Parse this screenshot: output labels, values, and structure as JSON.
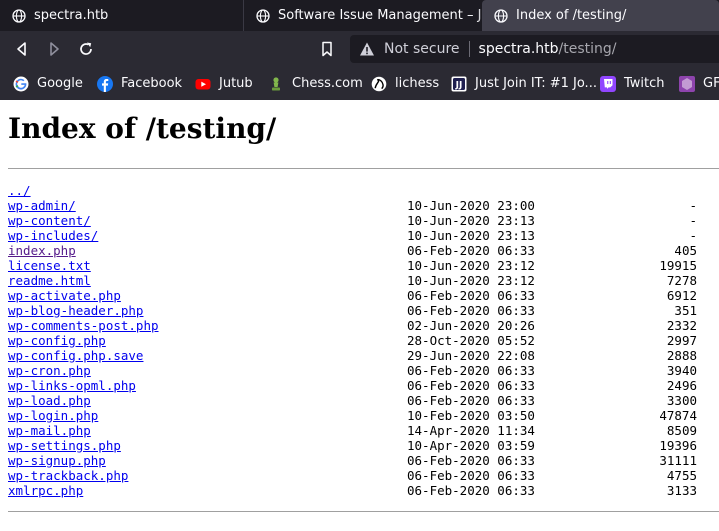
{
  "tabs": [
    {
      "title": "spectra.htb",
      "active": false,
      "icon": "globe-icon"
    },
    {
      "title": "Software Issue Management – Just",
      "active": false,
      "icon": "globe-icon"
    },
    {
      "title": "Index of /testing/",
      "active": true,
      "icon": "globe-icon"
    }
  ],
  "navbar": {
    "security_text": "Not secure",
    "url_host": "spectra.htb",
    "url_path": "/testing/"
  },
  "bookmarks": [
    {
      "label": "Google",
      "icon": "google-icon"
    },
    {
      "label": "Facebook",
      "icon": "facebook-icon"
    },
    {
      "label": "Jutub",
      "icon": "youtube-icon"
    },
    {
      "label": "Chess.com",
      "icon": "chess-pawn-icon"
    },
    {
      "label": "lichess",
      "icon": "lichess-icon"
    },
    {
      "label": "Just Join IT: #1 Jo...",
      "icon": "justjoinit-icon"
    },
    {
      "label": "Twitch",
      "icon": "twitch-icon"
    },
    {
      "label": "GF",
      "icon": "gf-icon"
    }
  ],
  "page": {
    "heading": "Index of /testing/",
    "parent_link": "../",
    "entries": [
      {
        "name": "wp-admin/",
        "date": "10-Jun-2020 23:00",
        "size": "-"
      },
      {
        "name": "wp-content/",
        "date": "10-Jun-2020 23:13",
        "size": "-"
      },
      {
        "name": "wp-includes/",
        "date": "10-Jun-2020 23:13",
        "size": "-"
      },
      {
        "name": "index.php",
        "date": "06-Feb-2020 06:33",
        "size": "405",
        "visited": true
      },
      {
        "name": "license.txt",
        "date": "10-Jun-2020 23:12",
        "size": "19915"
      },
      {
        "name": "readme.html",
        "date": "10-Jun-2020 23:12",
        "size": "7278"
      },
      {
        "name": "wp-activate.php",
        "date": "06-Feb-2020 06:33",
        "size": "6912"
      },
      {
        "name": "wp-blog-header.php",
        "date": "06-Feb-2020 06:33",
        "size": "351"
      },
      {
        "name": "wp-comments-post.php",
        "date": "02-Jun-2020 20:26",
        "size": "2332"
      },
      {
        "name": "wp-config.php",
        "date": "28-Oct-2020 05:52",
        "size": "2997"
      },
      {
        "name": "wp-config.php.save",
        "date": "29-Jun-2020 22:08",
        "size": "2888"
      },
      {
        "name": "wp-cron.php",
        "date": "06-Feb-2020 06:33",
        "size": "3940"
      },
      {
        "name": "wp-links-opml.php",
        "date": "06-Feb-2020 06:33",
        "size": "2496"
      },
      {
        "name": "wp-load.php",
        "date": "06-Feb-2020 06:33",
        "size": "3300"
      },
      {
        "name": "wp-login.php",
        "date": "10-Feb-2020 03:50",
        "size": "47874"
      },
      {
        "name": "wp-mail.php",
        "date": "14-Apr-2020 11:34",
        "size": "8509"
      },
      {
        "name": "wp-settings.php",
        "date": "10-Apr-2020 03:59",
        "size": "19396"
      },
      {
        "name": "wp-signup.php",
        "date": "06-Feb-2020 06:33",
        "size": "31111"
      },
      {
        "name": "wp-trackback.php",
        "date": "06-Feb-2020 06:33",
        "size": "4755"
      },
      {
        "name": "xmlrpc.php",
        "date": "06-Feb-2020 06:33",
        "size": "3133"
      }
    ]
  },
  "colors": {
    "link": "#0000ee",
    "visited_link": "#551a8b",
    "chrome_dark": "#1c1b22",
    "toolbar": "#2b2a33",
    "active_tab": "#42414d"
  }
}
